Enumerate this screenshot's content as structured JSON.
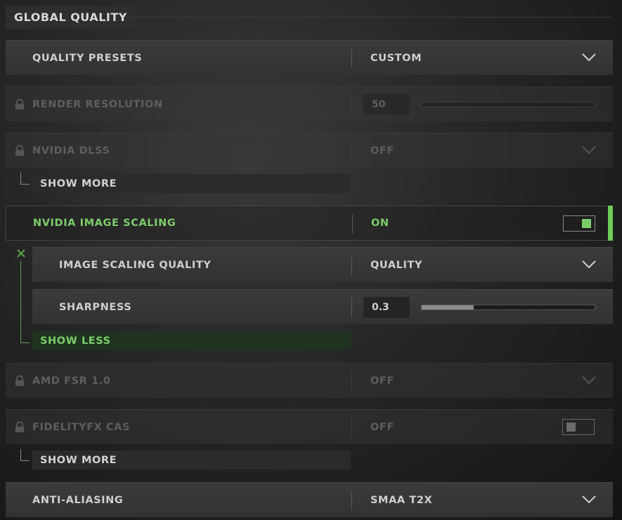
{
  "header": {
    "title": "GLOBAL QUALITY"
  },
  "settings": {
    "quality_presets": {
      "label": "QUALITY PRESETS",
      "value": "CUSTOM"
    },
    "render_resolution": {
      "label": "RENDER RESOLUTION",
      "value": "50",
      "slider_fraction": 0.0
    },
    "nvidia_dlss": {
      "label": "NVIDIA DLSS",
      "value": "OFF"
    },
    "dlss_show_more": {
      "label": "SHOW MORE"
    },
    "nvidia_image_scaling": {
      "label": "NVIDIA IMAGE SCALING",
      "value": "ON",
      "toggle": true
    },
    "image_scaling_quality": {
      "label": "IMAGE SCALING QUALITY",
      "value": "QUALITY"
    },
    "sharpness": {
      "label": "SHARPNESS",
      "value": "0.3",
      "slider_fraction": 0.3
    },
    "nis_show_less": {
      "label": "SHOW LESS"
    },
    "amd_fsr": {
      "label": "AMD FSR 1.0",
      "value": "OFF"
    },
    "fidelityfx_cas": {
      "label": "FIDELITYFX CAS",
      "value": "OFF",
      "toggle": false
    },
    "cas_show_more": {
      "label": "SHOW MORE"
    },
    "anti_aliasing": {
      "label": "ANTI-ALIASING",
      "value": "SMAA T2X"
    }
  },
  "colors": {
    "accent_green": "#7ccd6a",
    "locked_text": "#5e5e5e",
    "text": "#cfcfcf"
  },
  "icons": {
    "lock": "lock-icon",
    "dropdown": "chevron-down-icon",
    "collapse": "close-icon"
  }
}
